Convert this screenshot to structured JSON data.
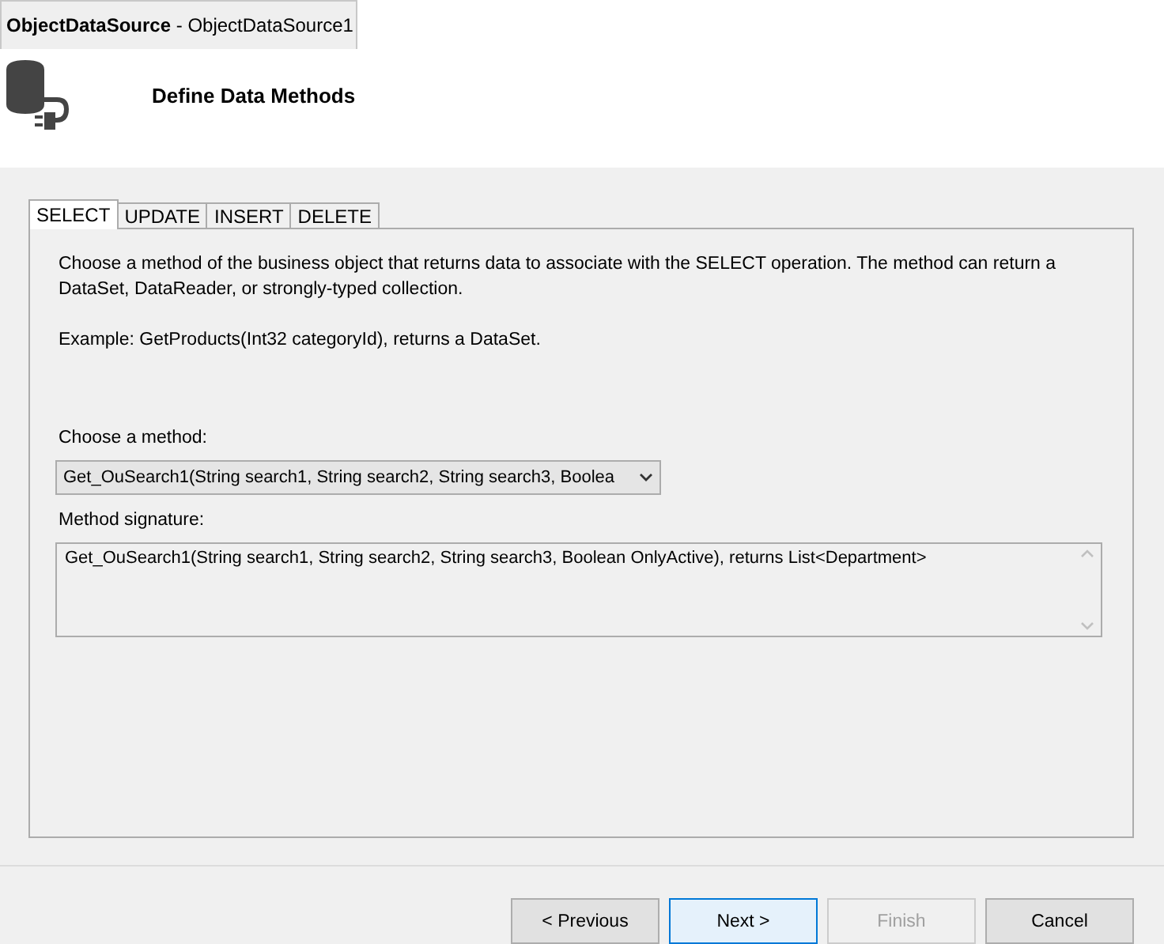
{
  "window": {
    "title_bold": "ObjectDataSource",
    "title_rest": " - ObjectDataSource1"
  },
  "header": {
    "title": "Define Data Methods"
  },
  "tabs": [
    {
      "label": "SELECT",
      "selected": true
    },
    {
      "label": "UPDATE",
      "selected": false
    },
    {
      "label": "INSERT",
      "selected": false
    },
    {
      "label": "DELETE",
      "selected": false
    }
  ],
  "description": "Choose a method of the business object that returns data to associate with the SELECT operation. The method can return a DataSet, DataReader, or strongly-typed collection.",
  "example": "Example: GetProducts(Int32 categoryId), returns a DataSet.",
  "method_label": "Choose a method:",
  "method_value": "Get_OuSearch1(String search1, String search2, String search3, Boolea",
  "signature_label": "Method signature:",
  "signature_value": "Get_OuSearch1(String search1, String search2, String search3, Boolean OnlyActive), returns List<Department>",
  "buttons": [
    {
      "label": "< Previous",
      "disabled": false,
      "default": false
    },
    {
      "label": "Next >",
      "disabled": false,
      "default": true
    },
    {
      "label": "Finish",
      "disabled": true,
      "default": false
    },
    {
      "label": "Cancel",
      "disabled": false,
      "default": false
    }
  ]
}
